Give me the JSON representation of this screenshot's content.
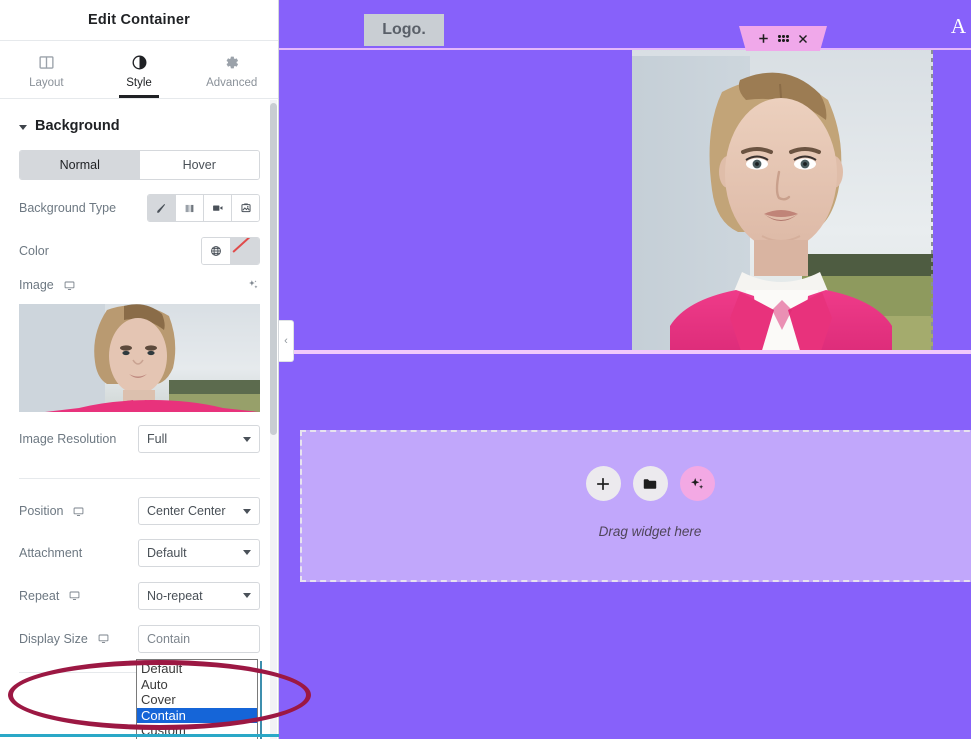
{
  "panel": {
    "title": "Edit Container",
    "tabs": [
      {
        "label": "Layout",
        "icon": "columns-icon",
        "active": false
      },
      {
        "label": "Style",
        "icon": "contrast-icon",
        "active": true
      },
      {
        "label": "Advanced",
        "icon": "gear-icon",
        "active": false
      }
    ],
    "section": {
      "title": "Background",
      "expanded": true
    },
    "state_tabs": {
      "normal": "Normal",
      "hover": "Hover",
      "active": "Normal"
    },
    "background_type": {
      "label": "Background Type",
      "options": [
        "classic-brush-icon",
        "gradient-icon",
        "video-icon",
        "slideshow-icon"
      ],
      "active_index": 0
    },
    "color": {
      "label": "Color",
      "globe_icon": "globe-icon",
      "swatch_icon": "no-color-swatch-icon"
    },
    "image": {
      "label": "Image",
      "device_icon": "desktop-icon",
      "ai_icon": "ai-sparkle-icon"
    },
    "fields": [
      {
        "name": "image-resolution",
        "label": "Image Resolution",
        "value": "Full",
        "device_icon": false
      },
      {
        "name": "position",
        "label": "Position",
        "value": "Center Center",
        "device_icon": true
      },
      {
        "name": "attachment",
        "label": "Attachment",
        "value": "Default",
        "device_icon": false
      },
      {
        "name": "repeat",
        "label": "Repeat",
        "value": "No-repeat",
        "device_icon": true
      },
      {
        "name": "display-size",
        "label": "Display Size",
        "value": "Contain",
        "device_icon": true
      }
    ],
    "display_size_dropdown": {
      "open": true,
      "selected": "Contain",
      "options": [
        "Default",
        "Auto",
        "Cover",
        "Contain",
        "Custom"
      ]
    }
  },
  "canvas": {
    "logo_text": "Logo.",
    "edge_letter": "A",
    "element_toolbar": {
      "add_icon": "plus-icon",
      "drag_icon": "drag-handle-icon",
      "close_icon": "close-icon"
    },
    "dropzone": {
      "label": "Drag widget here",
      "buttons": [
        {
          "name": "add-widget-button",
          "icon": "plus-icon"
        },
        {
          "name": "add-template-button",
          "icon": "folder-icon"
        },
        {
          "name": "ai-button",
          "icon": "ai-sparkle-icon"
        }
      ]
    },
    "collapse_handle": {
      "icon": "chevron-left-icon",
      "glyph": "‹"
    }
  },
  "colors": {
    "canvas_purple": "#8761fa",
    "dropzone_purple": "#c1a7fb",
    "toolbar_pink": "#f0a8ea",
    "divider_pink": "#f0c9fb",
    "annotation_maroon": "#9c1843",
    "dropdown_highlight": "#1565d8",
    "accent_teal": "#2aa8c7"
  }
}
